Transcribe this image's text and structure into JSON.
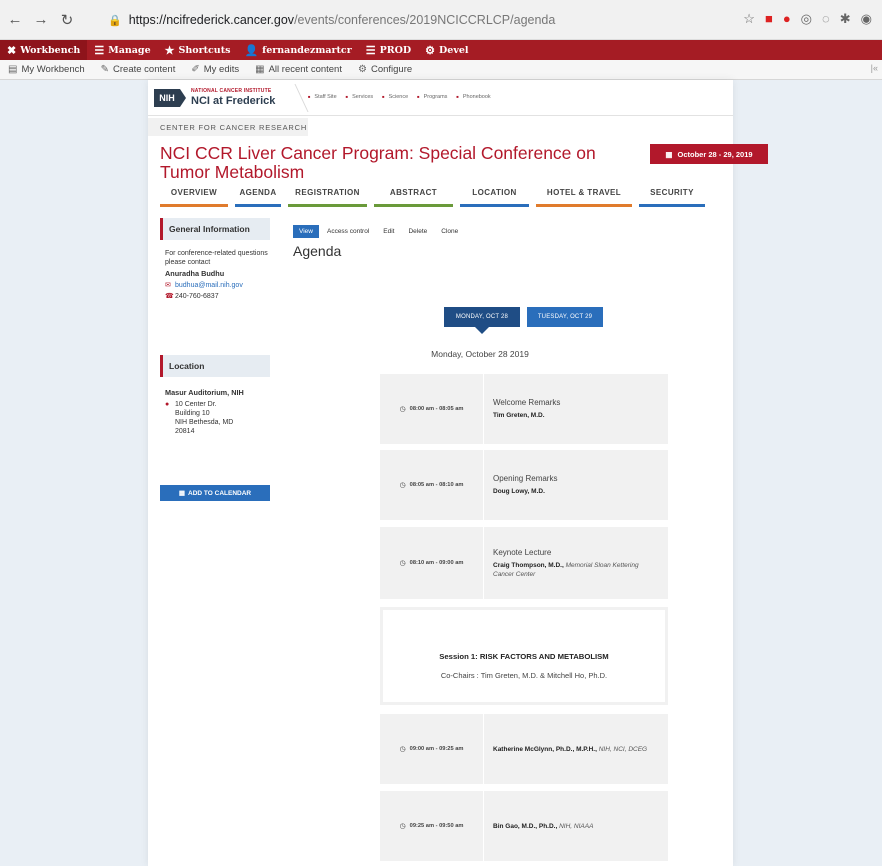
{
  "browser": {
    "url_host": "https://ncifrederick.cancer.gov",
    "url_path": "/events/conferences/2019NCICCRLCP/agenda"
  },
  "admin_bar": {
    "items": [
      "Workbench",
      "Manage",
      "Shortcuts",
      "fernandezmartcr",
      "PROD",
      "Devel"
    ]
  },
  "tool_bar": {
    "items": [
      "My Workbench",
      "Create content",
      "My edits",
      "All recent content",
      "Configure"
    ]
  },
  "site": {
    "logo_box": "NIH",
    "logo_top": "NATIONAL CANCER INSTITUTE",
    "logo_bottom": "NCI at Frederick",
    "nav": [
      "Staff Site",
      "Services",
      "Science",
      "Programs",
      "Phonebook"
    ]
  },
  "section_label": "CENTER FOR CANCER RESEARCH",
  "page_title": "NCI CCR Liver Cancer Program: Special Conference on Tumor Metabolism",
  "date_badge": "October 28 - 29, 2019",
  "tabs": [
    {
      "label": "OVERVIEW",
      "color": "#e07b2c"
    },
    {
      "label": "AGENDA",
      "color": "#2a6ebb"
    },
    {
      "label": "REGISTRATION",
      "color": "#6a9a3a"
    },
    {
      "label": "ABSTRACT",
      "color": "#6a9a3a"
    },
    {
      "label": "LOCATION",
      "color": "#2a6ebb"
    },
    {
      "label": "HOTEL & TRAVEL",
      "color": "#e07b2c"
    },
    {
      "label": "SECURITY",
      "color": "#2a6ebb"
    }
  ],
  "sidebar": {
    "general": {
      "heading": "General Information",
      "intro": "For conference-related questions please contact",
      "contact_name": "Anuradha Budhu",
      "email": "budhua@mail.nih.gov",
      "phone": "240-760-6837"
    },
    "location": {
      "heading": "Location",
      "venue": "Masur Auditorium, NIH",
      "address_1": "10 Center Dr.",
      "address_2": "Building 10",
      "address_3": "NIH Bethesda, MD",
      "address_4": "20814"
    },
    "calendar_button": "ADD TO CALENDAR"
  },
  "actions": [
    "View",
    "Access control",
    "Edit",
    "Delete",
    "Clone"
  ],
  "agenda_heading": "Agenda",
  "days": [
    "MONDAY, OCT 28",
    "TUESDAY, OCT 29"
  ],
  "day_label": "Monday, October 28 2019",
  "sessions": [
    {
      "time": "08:00 am - 08:05 am",
      "title": "Welcome Remarks",
      "speaker": "Tim Greten, M.D.",
      "affiliation": ""
    },
    {
      "time": "08:05 am - 08:10 am",
      "title": "Opening Remarks",
      "speaker": "Doug Lowy, M.D.",
      "affiliation": ""
    },
    {
      "time": "08:10 am - 09:00 am",
      "title": "Keynote Lecture",
      "speaker": "Craig Thompson, M.D.,",
      "affiliation": "Memorial Sloan Kettering Cancer Center"
    },
    {
      "time": "09:00 am - 09:25 am",
      "title": "",
      "speaker": "Katherine McGlynn, Ph.D., M.P.H.,",
      "affiliation": "NIH, NCI, DCEG"
    },
    {
      "time": "09:25 am - 09:50 am",
      "title": "",
      "speaker": "Bin Gao, M.D., Ph.D.,",
      "affiliation": "NIH, NIAAA"
    }
  ],
  "session_block": {
    "title": "Session 1: RISK FACTORS AND METABOLISM",
    "chairs": "Co-Chairs : Tim Greten, M.D. & Mitchell Ho, Ph.D."
  }
}
